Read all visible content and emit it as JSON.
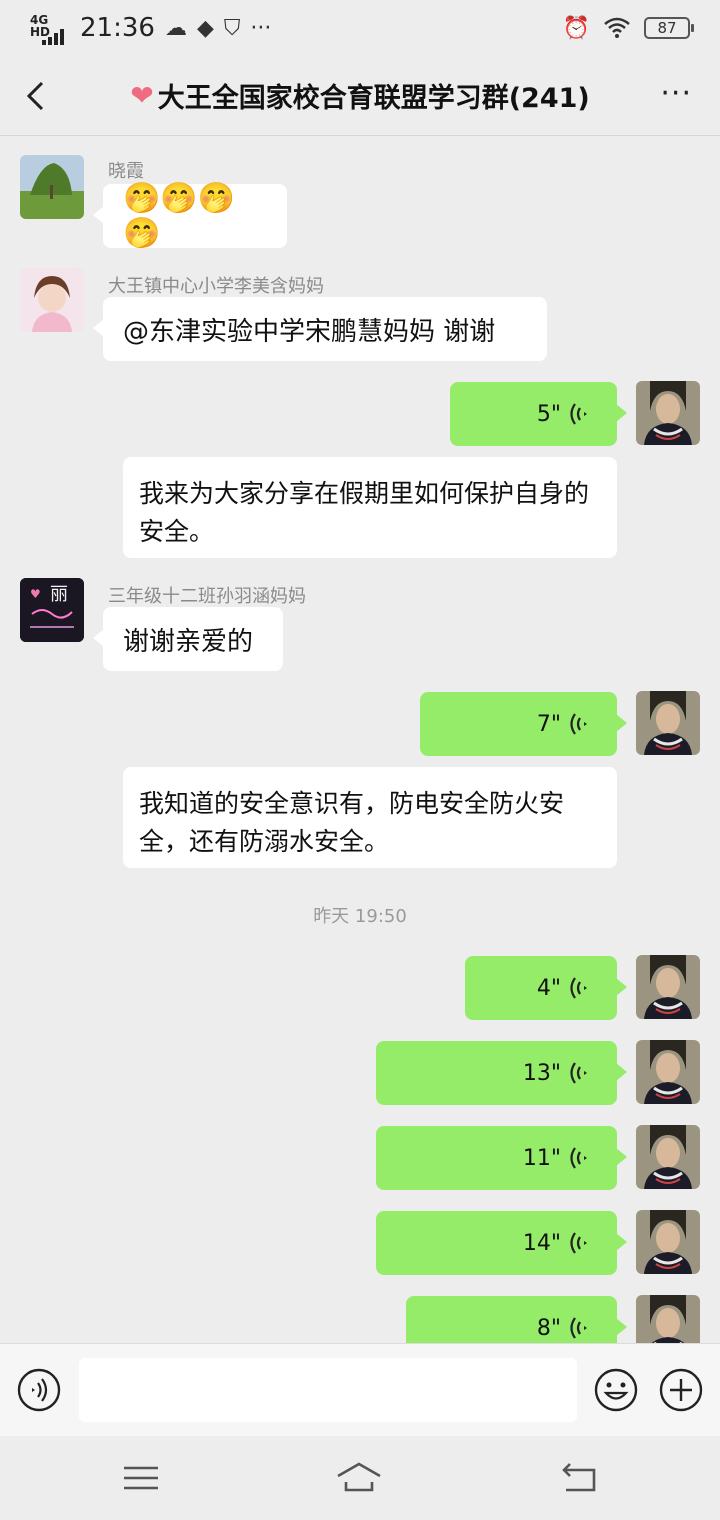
{
  "status_bar": {
    "network": "4G HD",
    "time": "21:36",
    "battery": "87"
  },
  "header": {
    "title_emoji": "❤",
    "title": "大王全国家校合育联盟学习群(241)",
    "more": "···"
  },
  "messages": [
    {
      "type": "text-left",
      "sender": "晓霞",
      "text": "🤭🤭🤭🤭"
    },
    {
      "type": "text-left",
      "sender": "大王镇中心小学李美含妈妈",
      "text": "@东津实验中学宋鹏慧妈妈  谢谢"
    },
    {
      "type": "voice-right",
      "duration": "5\""
    },
    {
      "type": "transcript",
      "text": "我来为大家分享在假期里如何保护自身的安全。"
    },
    {
      "type": "text-left",
      "sender": "三年级十二班孙羽涵妈妈",
      "text": "谢谢亲爱的",
      "avatar_text": "丽"
    },
    {
      "type": "voice-right",
      "duration": "7\""
    },
    {
      "type": "transcript",
      "text": "我知道的安全意识有，防电安全防火安全，还有防溺水安全。"
    },
    {
      "type": "timestamp",
      "text": "昨天 19:50"
    },
    {
      "type": "voice-right",
      "duration": "4\""
    },
    {
      "type": "voice-right",
      "duration": "13\""
    },
    {
      "type": "voice-right",
      "duration": "11\""
    },
    {
      "type": "voice-right",
      "duration": "14\""
    },
    {
      "type": "voice-right",
      "duration": "8\""
    }
  ],
  "input_bar": {
    "voice_icon": "voice-mode-icon",
    "emoji_icon": "emoji-icon",
    "plus_icon": "plus-icon"
  },
  "nav": {
    "menu_icon": "menu-icon",
    "home_icon": "home-icon",
    "back_icon": "back-icon"
  }
}
